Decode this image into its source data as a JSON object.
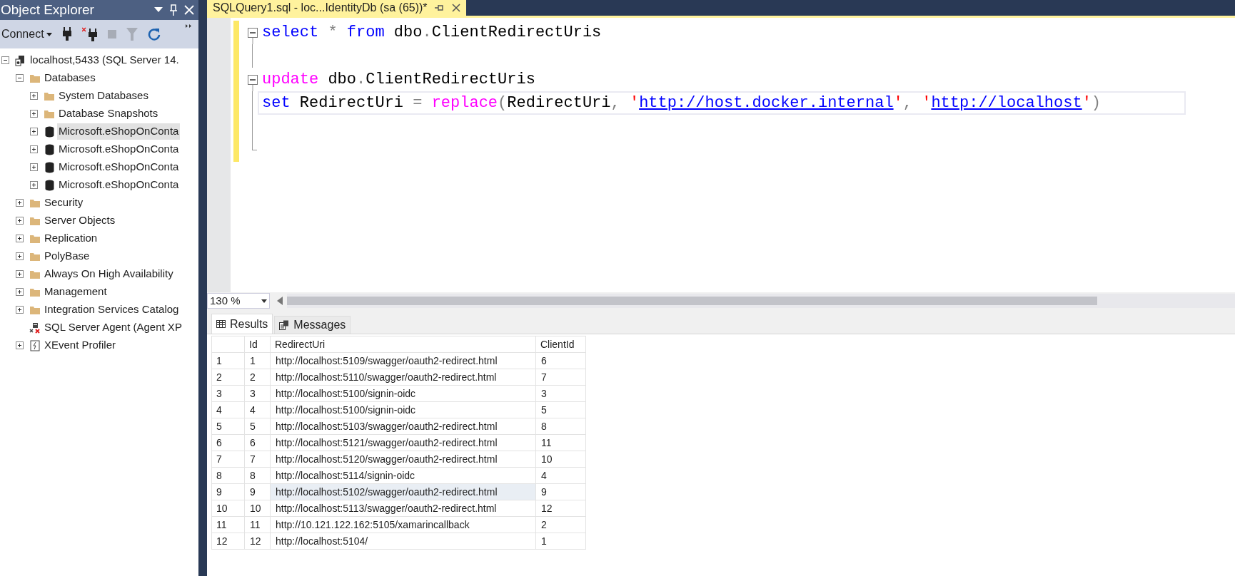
{
  "object_explorer": {
    "title": "Object Explorer",
    "connect": "Connect",
    "tree": [
      {
        "label": "localhost,5433 (SQL Server 14.",
        "kind": "server",
        "expanded": true,
        "selected": false,
        "children": [
          {
            "label": "Databases",
            "kind": "folder",
            "expanded": true,
            "selected": false,
            "children": [
              {
                "label": "System Databases",
                "kind": "folder",
                "expanded": false,
                "selected": false
              },
              {
                "label": "Database Snapshots",
                "kind": "folder",
                "expanded": false,
                "selected": false
              },
              {
                "label": "Microsoft.eShopOnConta",
                "kind": "database",
                "expanded": false,
                "selected": true
              },
              {
                "label": "Microsoft.eShopOnConta",
                "kind": "database",
                "expanded": false,
                "selected": false
              },
              {
                "label": "Microsoft.eShopOnConta",
                "kind": "database",
                "expanded": false,
                "selected": false
              },
              {
                "label": "Microsoft.eShopOnConta",
                "kind": "database",
                "expanded": false,
                "selected": false
              }
            ]
          },
          {
            "label": "Security",
            "kind": "folder",
            "expanded": false,
            "selected": false
          },
          {
            "label": "Server Objects",
            "kind": "folder",
            "expanded": false,
            "selected": false
          },
          {
            "label": "Replication",
            "kind": "folder",
            "expanded": false,
            "selected": false
          },
          {
            "label": "PolyBase",
            "kind": "folder",
            "expanded": false,
            "selected": false
          },
          {
            "label": "Always On High Availability",
            "kind": "folder",
            "expanded": false,
            "selected": false
          },
          {
            "label": "Management",
            "kind": "folder",
            "expanded": false,
            "selected": false
          },
          {
            "label": "Integration Services Catalog",
            "kind": "folder",
            "expanded": false,
            "selected": false
          },
          {
            "label": "SQL Server Agent (Agent XP",
            "kind": "agent",
            "selected": false
          },
          {
            "label": "XEvent Profiler",
            "kind": "xevent",
            "expanded": false,
            "selected": false
          }
        ]
      }
    ]
  },
  "editor": {
    "tab": "SQLQuery1.sql - loc...IdentityDb (sa (65))*",
    "lines": [
      {
        "kind": "block_start",
        "changed": true,
        "current": false,
        "tokens": [
          {
            "kind": "keyword",
            "text": "select"
          },
          {
            "kind": "operator",
            "text": " * "
          },
          {
            "kind": "keyword",
            "text": "from"
          },
          {
            "kind": "text",
            "text": " dbo"
          },
          {
            "kind": "operator",
            "text": "."
          },
          {
            "kind": "text",
            "text": "ClientRedirectUris"
          }
        ]
      },
      {
        "kind": "block_body",
        "changed": true,
        "current": false
      },
      {
        "kind": "block_start",
        "changed": true,
        "current": false,
        "tokens": [
          {
            "kind": "function",
            "text": "update"
          },
          {
            "kind": "text",
            "text": " dbo"
          },
          {
            "kind": "operator",
            "text": "."
          },
          {
            "kind": "text",
            "text": "ClientRedirectUris"
          }
        ]
      },
      {
        "kind": "block_body",
        "changed": true,
        "current": true,
        "tokens": [
          {
            "kind": "keyword",
            "text": "set"
          },
          {
            "kind": "text",
            "text": " RedirectUri "
          },
          {
            "kind": "operator",
            "text": "="
          },
          {
            "kind": "function",
            "text": " replace"
          },
          {
            "kind": "operator",
            "text": "("
          },
          {
            "kind": "text",
            "text": "RedirectUri"
          },
          {
            "kind": "operator",
            "text": ","
          },
          {
            "kind": "string",
            "text": " '"
          },
          {
            "kind": "link",
            "text": "http://host.docker.internal"
          },
          {
            "kind": "string",
            "text": "'"
          },
          {
            "kind": "operator",
            "text": ","
          },
          {
            "kind": "string",
            "text": " '"
          },
          {
            "kind": "link",
            "text": "http://localhost"
          },
          {
            "kind": "string",
            "text": "'"
          },
          {
            "kind": "operator",
            "text": ")"
          }
        ]
      },
      {
        "kind": "block_body",
        "changed": true,
        "current": false
      },
      {
        "kind": "block_end",
        "changed": true,
        "current": false
      }
    ]
  },
  "zoom": "130 %",
  "result_tabs": [
    {
      "label": "Results",
      "kind": "grid",
      "selected": true
    },
    {
      "label": "Messages",
      "kind": "messages",
      "selected": false
    }
  ],
  "grid": {
    "columns": [
      "Id",
      "RedirectUri",
      "ClientId"
    ],
    "rows": [
      {
        "number": "1",
        "cells": [
          {
            "text": "1",
            "selected": false
          },
          {
            "text": "http://localhost:5109/swagger/oauth2-redirect.html",
            "selected": false
          },
          {
            "text": "6",
            "selected": false
          }
        ]
      },
      {
        "number": "2",
        "cells": [
          {
            "text": "2",
            "selected": false
          },
          {
            "text": "http://localhost:5110/swagger/oauth2-redirect.html",
            "selected": false
          },
          {
            "text": "7",
            "selected": false
          }
        ]
      },
      {
        "number": "3",
        "cells": [
          {
            "text": "3",
            "selected": false
          },
          {
            "text": "http://localhost:5100/signin-oidc",
            "selected": false
          },
          {
            "text": "3",
            "selected": false
          }
        ]
      },
      {
        "number": "4",
        "cells": [
          {
            "text": "4",
            "selected": false
          },
          {
            "text": "http://localhost:5100/signin-oidc",
            "selected": false
          },
          {
            "text": "5",
            "selected": false
          }
        ]
      },
      {
        "number": "5",
        "cells": [
          {
            "text": "5",
            "selected": false
          },
          {
            "text": "http://localhost:5103/swagger/oauth2-redirect.html",
            "selected": false
          },
          {
            "text": "8",
            "selected": false
          }
        ]
      },
      {
        "number": "6",
        "cells": [
          {
            "text": "6",
            "selected": false
          },
          {
            "text": "http://localhost:5121/swagger/oauth2-redirect.html",
            "selected": false
          },
          {
            "text": "11",
            "selected": false
          }
        ]
      },
      {
        "number": "7",
        "cells": [
          {
            "text": "7",
            "selected": false
          },
          {
            "text": "http://localhost:5120/swagger/oauth2-redirect.html",
            "selected": false
          },
          {
            "text": "10",
            "selected": false
          }
        ]
      },
      {
        "number": "8",
        "cells": [
          {
            "text": "8",
            "selected": false
          },
          {
            "text": "http://localhost:5114/signin-oidc",
            "selected": false
          },
          {
            "text": "4",
            "selected": false
          }
        ]
      },
      {
        "number": "9",
        "cells": [
          {
            "text": "9",
            "selected": false
          },
          {
            "text": "http://localhost:5102/swagger/oauth2-redirect.html",
            "selected": true
          },
          {
            "text": "9",
            "selected": false
          }
        ]
      },
      {
        "number": "10",
        "cells": [
          {
            "text": "10",
            "selected": false
          },
          {
            "text": "http://localhost:5113/swagger/oauth2-redirect.html",
            "selected": false
          },
          {
            "text": "12",
            "selected": false
          }
        ]
      },
      {
        "number": "11",
        "cells": [
          {
            "text": "11",
            "selected": false
          },
          {
            "text": "http://10.121.122.162:5105/xamarincallback",
            "selected": false
          },
          {
            "text": "2",
            "selected": false
          }
        ]
      },
      {
        "number": "12",
        "cells": [
          {
            "text": "12",
            "selected": false
          },
          {
            "text": "http://localhost:5104/",
            "selected": false
          },
          {
            "text": "1",
            "selected": false
          }
        ]
      }
    ]
  }
}
